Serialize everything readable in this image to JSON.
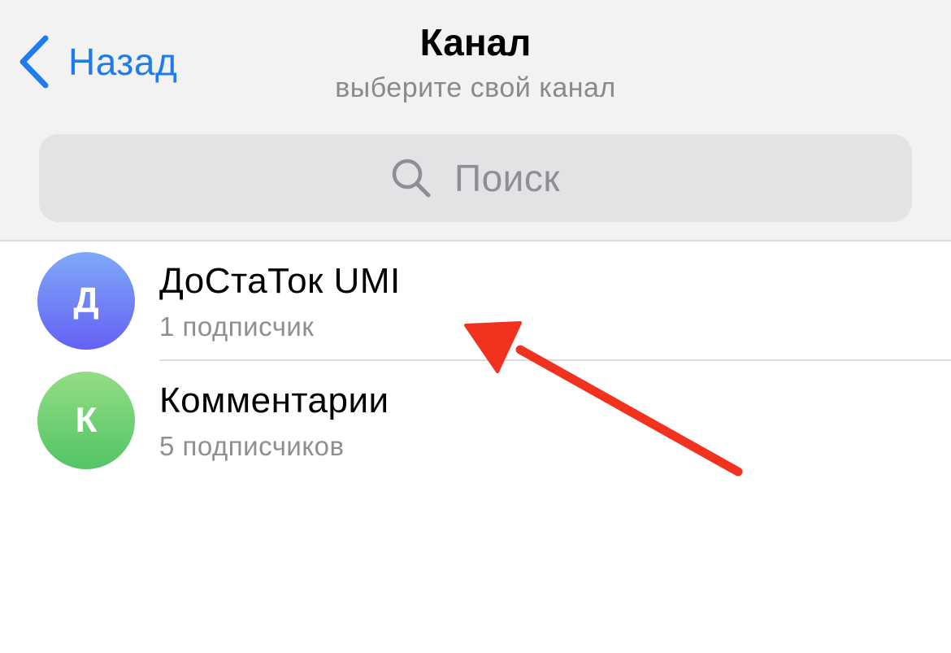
{
  "nav": {
    "back_label": "Назад",
    "title": "Канал",
    "subtitle": "выберите свой канал"
  },
  "search": {
    "placeholder": "Поиск",
    "icon": "search-icon"
  },
  "channels": [
    {
      "initial": "Д",
      "name": "ДоСтаТок UMI",
      "subscribers": "1 подписчик",
      "avatar_colors": [
        "#7ea9f7",
        "#6561f4"
      ]
    },
    {
      "initial": "К",
      "name": "Комментарии",
      "subscribers": "5 подписчиков",
      "avatar_colors": [
        "#93dd84",
        "#54c466"
      ]
    }
  ],
  "colors": {
    "accent": "#1f7cf0",
    "header_bg": "#f2f2f3",
    "search_bg": "#e3e3e6",
    "secondary_text": "#8e8e93",
    "annotation_arrow": "#f0321e"
  }
}
